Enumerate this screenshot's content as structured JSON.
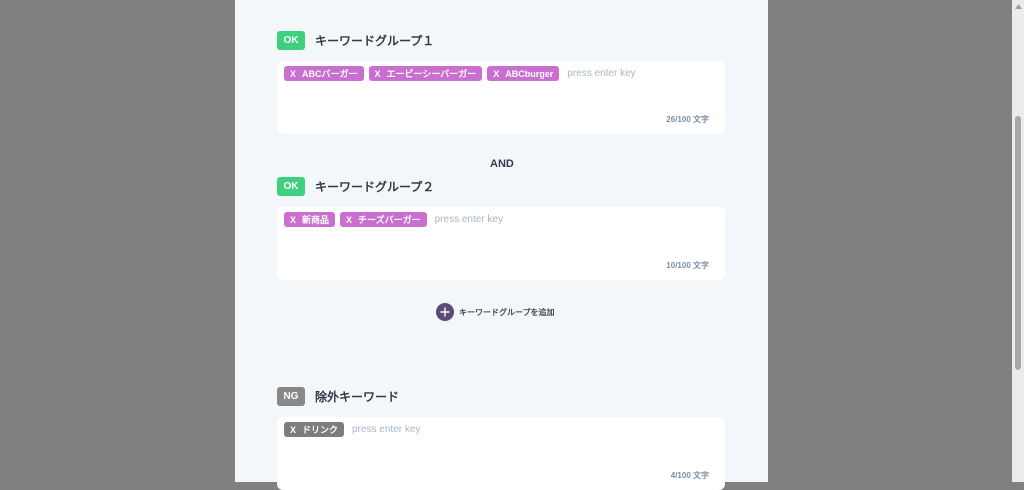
{
  "group1": {
    "badge": "OK",
    "title": "キーワードグループ１",
    "tags": [
      "ABCバーガー",
      "エービーシーバーガー",
      "ABCburger"
    ],
    "placeholder": "press enter key",
    "counter": "26/100 文字"
  },
  "and_label": "AND",
  "group2": {
    "badge": "OK",
    "title": "キーワードグループ２",
    "tags": [
      "新商品",
      "チーズバーガー"
    ],
    "placeholder": "press enter key",
    "counter": "10/100 文字"
  },
  "add_group_label": "キーワードグループを追加",
  "exclude": {
    "badge": "NG",
    "title": "除外キーワード",
    "tags": [
      "ドリンク"
    ],
    "placeholder": "press enter key",
    "counter": "4/100 文字"
  },
  "tag_remove_glyph": "X",
  "colors": {
    "ok_badge": "#3fd07f",
    "ng_badge": "#888888",
    "tag_purple": "#c96fcf",
    "tag_gray": "#7d7d7d",
    "add_circle": "#5a4b79",
    "panel_bg": "#f3f7f9",
    "backdrop": "#808080"
  },
  "icons": {
    "add": "plus-icon",
    "remove": "remove-x-icon",
    "scroll_up": "scroll-up-arrow-icon"
  }
}
